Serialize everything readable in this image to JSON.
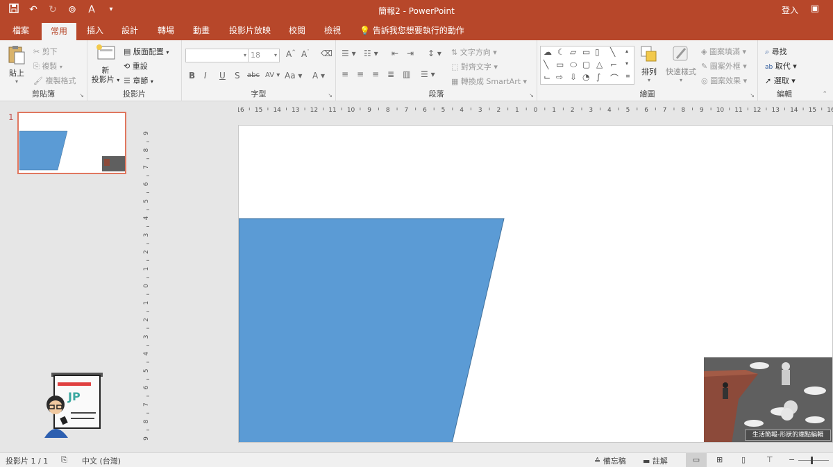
{
  "app": {
    "title": "簡報2 - PowerPoint",
    "signin": "登入"
  },
  "qat": {
    "save_icon": "save-icon",
    "undo_icon": "undo-icon",
    "redo_icon": "redo-icon",
    "presenter_icon": "start-from-beginning-icon",
    "font_icon": "font-color-icon",
    "customize_icon": "customize-qat-icon"
  },
  "tabs": [
    {
      "label": "檔案"
    },
    {
      "label": "常用"
    },
    {
      "label": "插入"
    },
    {
      "label": "設計"
    },
    {
      "label": "轉場"
    },
    {
      "label": "動畫"
    },
    {
      "label": "投影片放映"
    },
    {
      "label": "校閱"
    },
    {
      "label": "檢視"
    }
  ],
  "tellme": "告訴我您想要執行的動作",
  "ribbon": {
    "clipboard": {
      "label": "剪貼簿",
      "paste": "貼上",
      "cut": "剪下",
      "copy": "複製",
      "format_painter": "複製格式"
    },
    "slides": {
      "label": "投影片",
      "new_slide_line1": "新",
      "new_slide_line2": "投影片",
      "layout": "版面配置",
      "reset": "重設",
      "section": "章節"
    },
    "font": {
      "label": "字型",
      "font_name": "",
      "font_size": "18",
      "bold": "B",
      "italic": "I",
      "underline": "U",
      "shadow": "S",
      "strike": "abc",
      "spacing": "AV",
      "case": "Aa",
      "color": "A"
    },
    "paragraph": {
      "label": "段落",
      "text_direction": "文字方向",
      "align_text": "對齊文字",
      "smartart": "轉換成 SmartArt"
    },
    "drawing": {
      "label": "繪圖",
      "arrange": "排列",
      "quick_styles": "快速樣式",
      "fill": "圖案填滿",
      "outline": "圖案外框",
      "effects": "圖案效果"
    },
    "editing": {
      "label": "編輯",
      "find": "尋找",
      "replace": "取代",
      "select": "選取"
    }
  },
  "thumbnail": {
    "number": "1"
  },
  "watermark": {
    "text": "JP"
  },
  "ruler": {
    "h_ticks": [
      "16",
      "15",
      "14",
      "13",
      "12",
      "11",
      "10",
      "9",
      "8",
      "7",
      "6",
      "5",
      "4",
      "3",
      "2",
      "1",
      "0",
      "1",
      "2",
      "3",
      "4",
      "5",
      "6",
      "7",
      "8",
      "9",
      "10",
      "11",
      "12",
      "13",
      "14",
      "15",
      "16"
    ],
    "v_ticks": [
      "9",
      "8",
      "7",
      "6",
      "5",
      "4",
      "3",
      "2",
      "1",
      "0",
      "1",
      "2",
      "3",
      "4",
      "5",
      "6",
      "7",
      "8",
      "9"
    ]
  },
  "slide": {
    "shape_fill": "#5b9bd5",
    "shape_stroke": "#41719c"
  },
  "video": {
    "caption": "生活簡報-形狀的端點編輯"
  },
  "status": {
    "slide_info": "投影片 1 / 1",
    "language": "中文 (台灣)",
    "notes": "備忘稿",
    "comments": "註解"
  },
  "colors": {
    "accent": "#b7472a",
    "ribbon_bg": "#f3f3f3"
  }
}
